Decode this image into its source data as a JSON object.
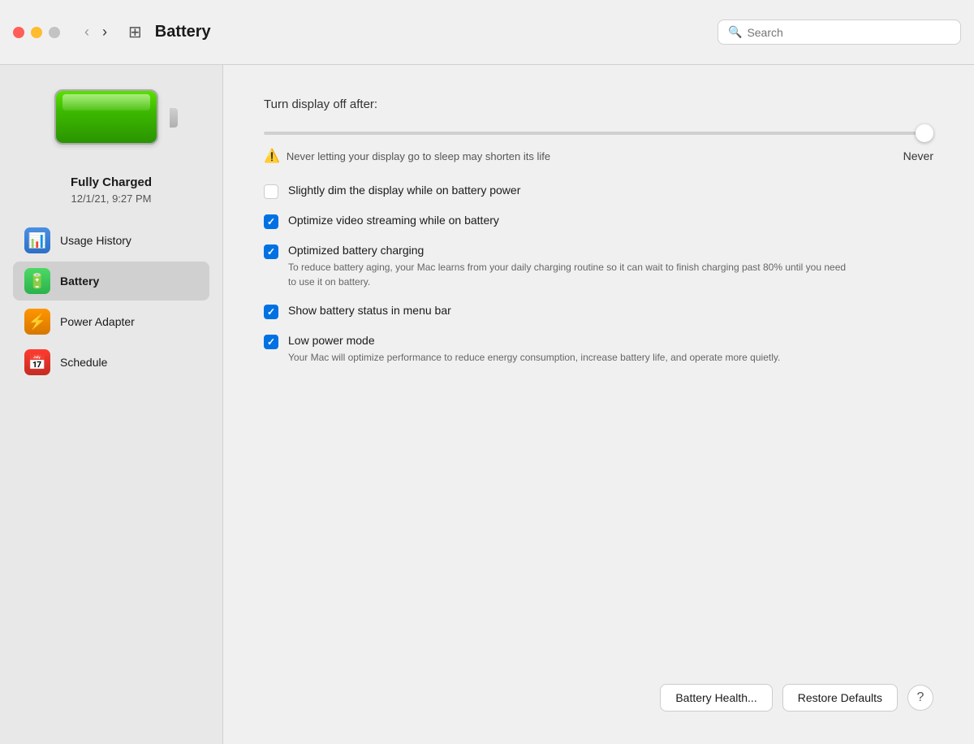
{
  "titlebar": {
    "title": "Battery",
    "search_placeholder": "Search",
    "grid_icon": "⊞"
  },
  "sidebar": {
    "battery_status": "Fully Charged",
    "battery_time": "12/1/21, 9:27 PM",
    "nav_items": [
      {
        "id": "usage-history",
        "label": "Usage History",
        "icon": "📊",
        "icon_class": "icon-usage",
        "active": false
      },
      {
        "id": "battery",
        "label": "Battery",
        "icon": "🔋",
        "icon_class": "icon-battery",
        "active": true
      },
      {
        "id": "power-adapter",
        "label": "Power Adapter",
        "icon": "⚡",
        "icon_class": "icon-power",
        "active": false
      },
      {
        "id": "schedule",
        "label": "Schedule",
        "icon": "📅",
        "icon_class": "icon-schedule",
        "active": false
      }
    ]
  },
  "content": {
    "slider_section": {
      "label": "Turn display off after:",
      "warning": "Never letting your display go to sleep may shorten its life",
      "never_label": "Never"
    },
    "options": [
      {
        "id": "dim-display",
        "label": "Slightly dim the display while on battery power",
        "description": "",
        "checked": false
      },
      {
        "id": "optimize-video",
        "label": "Optimize video streaming while on battery",
        "description": "",
        "checked": true
      },
      {
        "id": "optimized-charging",
        "label": "Optimized battery charging",
        "description": "To reduce battery aging, your Mac learns from your daily charging routine so it can wait to finish charging past 80% until you need to use it on battery.",
        "checked": true
      },
      {
        "id": "show-battery-status",
        "label": "Show battery status in menu bar",
        "description": "",
        "checked": true
      },
      {
        "id": "low-power-mode",
        "label": "Low power mode",
        "description": "Your Mac will optimize performance to reduce energy consumption, increase battery life, and operate more quietly.",
        "checked": true
      }
    ],
    "buttons": {
      "battery_health": "Battery Health...",
      "restore_defaults": "Restore Defaults",
      "help": "?"
    }
  }
}
